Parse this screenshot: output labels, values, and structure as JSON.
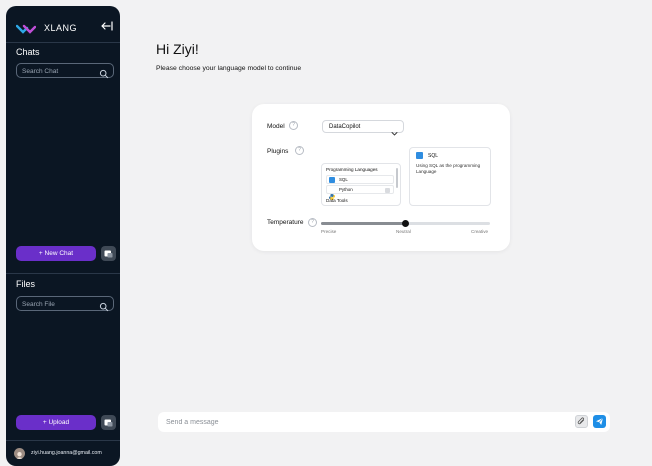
{
  "brand": {
    "name": "XLANG",
    "collapse_icon": "arrow-left-bar-icon"
  },
  "chats": {
    "title": "Chats",
    "search_placeholder": "Search Chat",
    "new_chat_label": "+ New Chat"
  },
  "files": {
    "title": "Files",
    "search_placeholder": "Search File",
    "upload_label": "+ Upload"
  },
  "user": {
    "email": "ziyi.huang.joanna@gmail.com"
  },
  "main": {
    "greeting": "Hi Ziyi!",
    "subtitle": "Please choose your language model to continue"
  },
  "card": {
    "model_label": "Model",
    "model_help": "?",
    "model_value": "DataCopilot",
    "plugins_label": "Plugins",
    "plugins_help": "?",
    "plugin_groups": [
      {
        "title": "Programming Languages",
        "items": [
          "SQL",
          "Python"
        ]
      },
      {
        "title": "Data Tools",
        "items": []
      }
    ],
    "selected_plugin": {
      "name": "SQL",
      "description": "Using SQL as the programming Language"
    },
    "temperature_label": "Temperature",
    "temperature_help": "?",
    "temperature_value": 0.5,
    "temperature_ticks": [
      "Precise",
      "Neutral",
      "Creative"
    ]
  },
  "composer": {
    "placeholder": "Send a message"
  },
  "colors": {
    "sidebar_bg": "#0b1623",
    "accent_purple": "#6a2fc9",
    "send_blue": "#1e8ee6",
    "page_bg": "#f2f2f3"
  }
}
